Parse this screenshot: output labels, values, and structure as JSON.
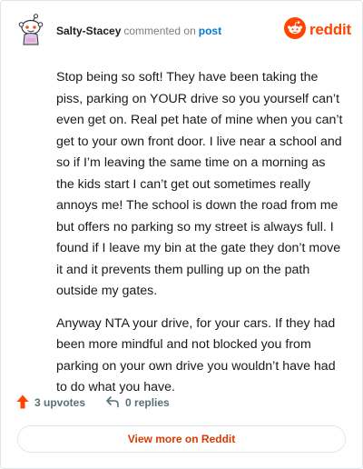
{
  "header": {
    "username": "Salty-Stacey",
    "verb": "commented on",
    "post_link": "post",
    "brand": "reddit"
  },
  "icons": {
    "avatar": "snoo-avatar-icon",
    "brand": "reddit-logo-icon",
    "upvote": "upvote-arrow-icon",
    "reply": "reply-arrow-icon"
  },
  "colors": {
    "brand": "#ff4500",
    "link": "#0079d3",
    "upvote": "#ff4500",
    "muted": "#576f76",
    "view_more": "#d93a00"
  },
  "comment": {
    "paragraphs": [
      "Stop being so soft! They have been taking the piss, parking on YOUR drive so you yourself can’t even get on. Real pet hate of mine when you can’t get to your own front door. I live near a school and so if I’m leaving the same time on a morning as the kids start I can’t get out sometimes really annoys me! The school is down the road from me but offers no parking so my street is always full. I found if I leave my bin at the gate they don’t move it and it prevents them pulling up on the path outside my gates.",
      "Anyway NTA your drive, for your cars. If they had been more mindful and not blocked you from parking on your own drive you wouldn’t have had to do what you have."
    ]
  },
  "actions": {
    "upvotes": "3 upvotes",
    "replies": "0 replies"
  },
  "footer": {
    "view_more": "View more on Reddit"
  }
}
